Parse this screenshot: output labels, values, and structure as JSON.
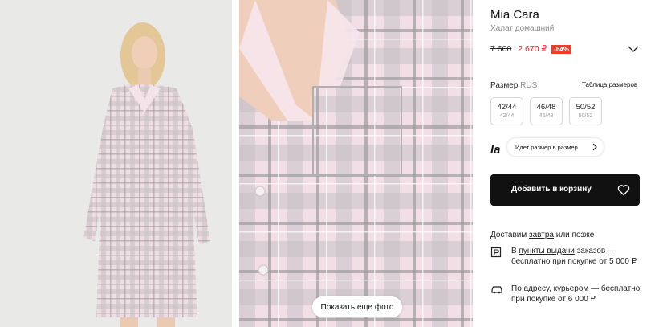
{
  "product": {
    "brand": "Mia Cara",
    "subtitle": "Халат домашний",
    "old_price": "7 600",
    "new_price": "2 670 ₽",
    "discount": "-64%"
  },
  "gallery": {
    "more_photos_label": "Показать еще фото"
  },
  "sizes": {
    "label": "Размер",
    "system": "RUS",
    "table_link": "Таблица размеров",
    "options": [
      {
        "main": "42/44",
        "alt": "42/44"
      },
      {
        "main": "46/48",
        "alt": "46/48"
      },
      {
        "main": "50/52",
        "alt": "50/52"
      }
    ]
  },
  "fit": {
    "logo": "la",
    "hint": "Идет размер в размер"
  },
  "cart": {
    "add_label": "Добавить в корзину"
  },
  "delivery": {
    "head_prefix": "Доставим",
    "head_link": "завтра",
    "head_suffix": "или позже",
    "pickup_prefix": "В",
    "pickup_link": "пункты выдачи",
    "pickup_rest": "заказов — бесплатно при покупке от 5 000 ₽",
    "courier_text": "По адресу, курьером — бесплатно при покупке от 6 000 ₽"
  },
  "icons": {
    "expand": "chevron-down-icon",
    "fit_arrow": "chevron-right-icon",
    "favorite": "heart-icon",
    "pickup": "pickup-point-icon",
    "courier": "car-icon"
  },
  "colors": {
    "price_red": "#e6242b",
    "discount_bg": "#f33b2a",
    "cart_bg": "#111111",
    "fabric_pink": "#eed6df",
    "fabric_grey": "#a9a5a8"
  }
}
